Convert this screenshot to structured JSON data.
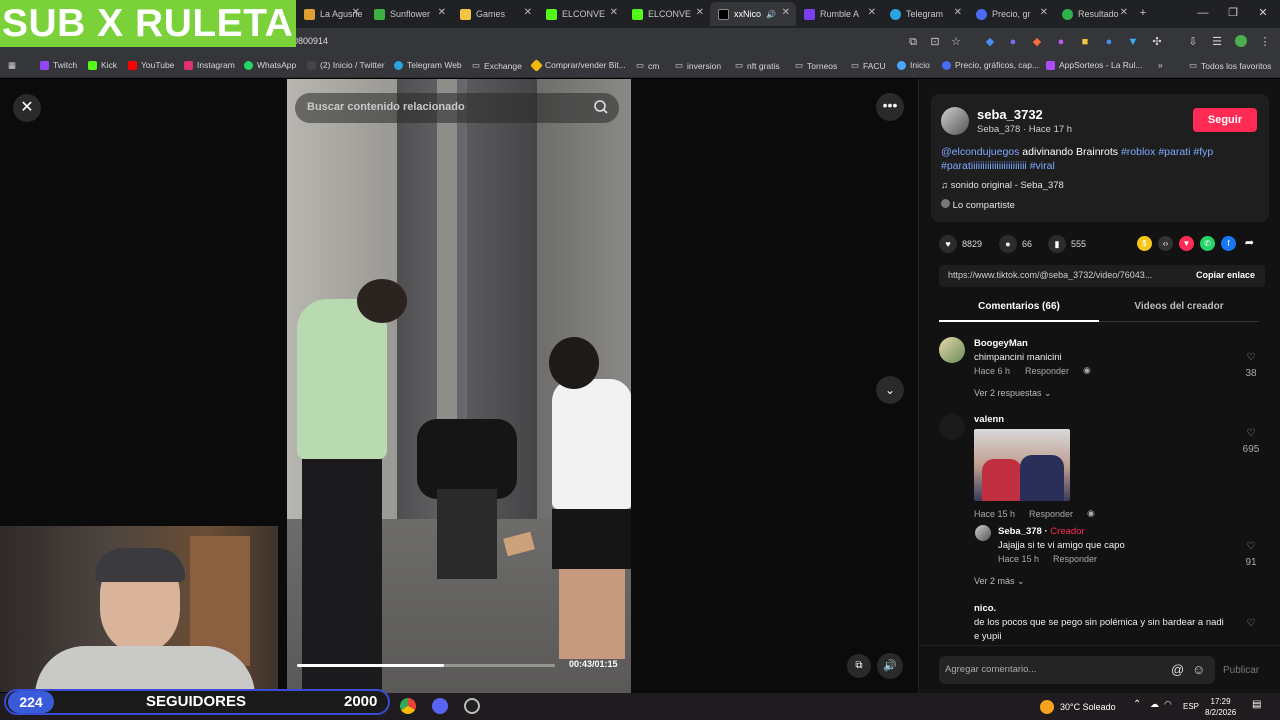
{
  "overlay": {
    "banner": "SUB X RULETA",
    "subs_count": "224",
    "subs_label": "SEGUIDORES",
    "subs_goal": "2000"
  },
  "browser": {
    "tabs": [
      {
        "label": "La Agusne",
        "color": "#e0a030"
      },
      {
        "label": "Sunflower",
        "color": "#3cb043"
      },
      {
        "label": "Games",
        "color": "#f5c542"
      },
      {
        "label": "ELCONVE",
        "color": "#53fc18"
      },
      {
        "label": "ELCONVE",
        "color": "#53fc18"
      },
      {
        "label": "xxNico",
        "color": "#000000"
      },
      {
        "label": "Rumble A",
        "color": "#7b3ff2"
      },
      {
        "label": "Telegram",
        "color": "#2aa3e0"
      },
      {
        "label": "Precio, gr",
        "color": "#4b6bf5"
      },
      {
        "label": "Resultado",
        "color": "#2fb24b"
      }
    ],
    "url": "0800914",
    "bookmarks": [
      {
        "label": "Twitch",
        "color": "#9146ff"
      },
      {
        "label": "Kick",
        "color": "#53fc18"
      },
      {
        "label": "YouTube",
        "color": "#ff0000"
      },
      {
        "label": "Instagram",
        "color": "#e1306c"
      },
      {
        "label": "WhatsApp",
        "color": "#25d366"
      },
      {
        "label": "(2) Inicio / Twitter",
        "color": "#444444"
      },
      {
        "label": "Telegram Web",
        "color": "#2aa3e0"
      },
      {
        "label": "Exchange",
        "color": "#888888"
      },
      {
        "label": "Comprar/vender Bit...",
        "color": "#f0b90b"
      },
      {
        "label": "cm",
        "color": "#888888"
      },
      {
        "label": "inversion",
        "color": "#888888"
      },
      {
        "label": "nft gratis",
        "color": "#888888"
      },
      {
        "label": "Torneos",
        "color": "#888888"
      },
      {
        "label": "FACU",
        "color": "#888888"
      },
      {
        "label": "Inicio",
        "color": "#4aa8ff"
      },
      {
        "label": "Precio, gráficos, cap...",
        "color": "#4b6bf5"
      },
      {
        "label": "AppSorteos - La Rul...",
        "color": "#b14bf5"
      }
    ],
    "all_bookmarks": "Todos los favoritos"
  },
  "video": {
    "search_placeholder": "Buscar contenido relacionado",
    "time": "00:43/01:15",
    "progress": 0.57
  },
  "post": {
    "username": "seba_3732",
    "display_name": "Seba_378",
    "time_ago": "Hace 17 h",
    "follow_label": "Seguir",
    "caption_mention": "@elcondujuegos",
    "caption_text": " adivinando Brainrots ",
    "caption_tags": [
      "#roblox",
      "#parati",
      "#fyp",
      "#paratiiiiiiiiiiiiiiiiiiiiiiii",
      "#viral"
    ],
    "music": "sonido original - Seba_378",
    "shared_label": "Lo compartiste",
    "likes": "8829",
    "comments": "66",
    "saves": "555",
    "link": "https://www.tiktok.com/@seba_3732/video/76043...",
    "copy_label": "Copiar enlace",
    "tab_comments": "Comentarios (66)",
    "tab_videos": "Videos del creador"
  },
  "comments": [
    {
      "name": "BoogeyMan",
      "text": "chimpancini manicini",
      "time": "Hace 6 h",
      "reply": "Responder",
      "likes": "38",
      "more": "Ver 2 respuestas"
    },
    {
      "name": "valenn",
      "text": "",
      "time": "Hace 15 h",
      "reply": "Responder",
      "likes": "695",
      "more": "Ver 2 más"
    },
    {
      "name": "Seba_378",
      "creator": "Creador",
      "text": "Jajajja si te vi amigo que capo",
      "time": "Hace 15 h",
      "reply": "Responder",
      "likes": "91"
    },
    {
      "name": "nico.",
      "text": "de los pocos que se pego sin polémica y sin bardear a nadi",
      "text2": "e yupii"
    }
  ],
  "add_comment": {
    "placeholder": "Agregar comentario...",
    "publish": "Publicar"
  },
  "taskbar": {
    "weather": "30°C  Soleado",
    "lang": "ESP",
    "time": "17:29",
    "date": "8/2/2026"
  }
}
